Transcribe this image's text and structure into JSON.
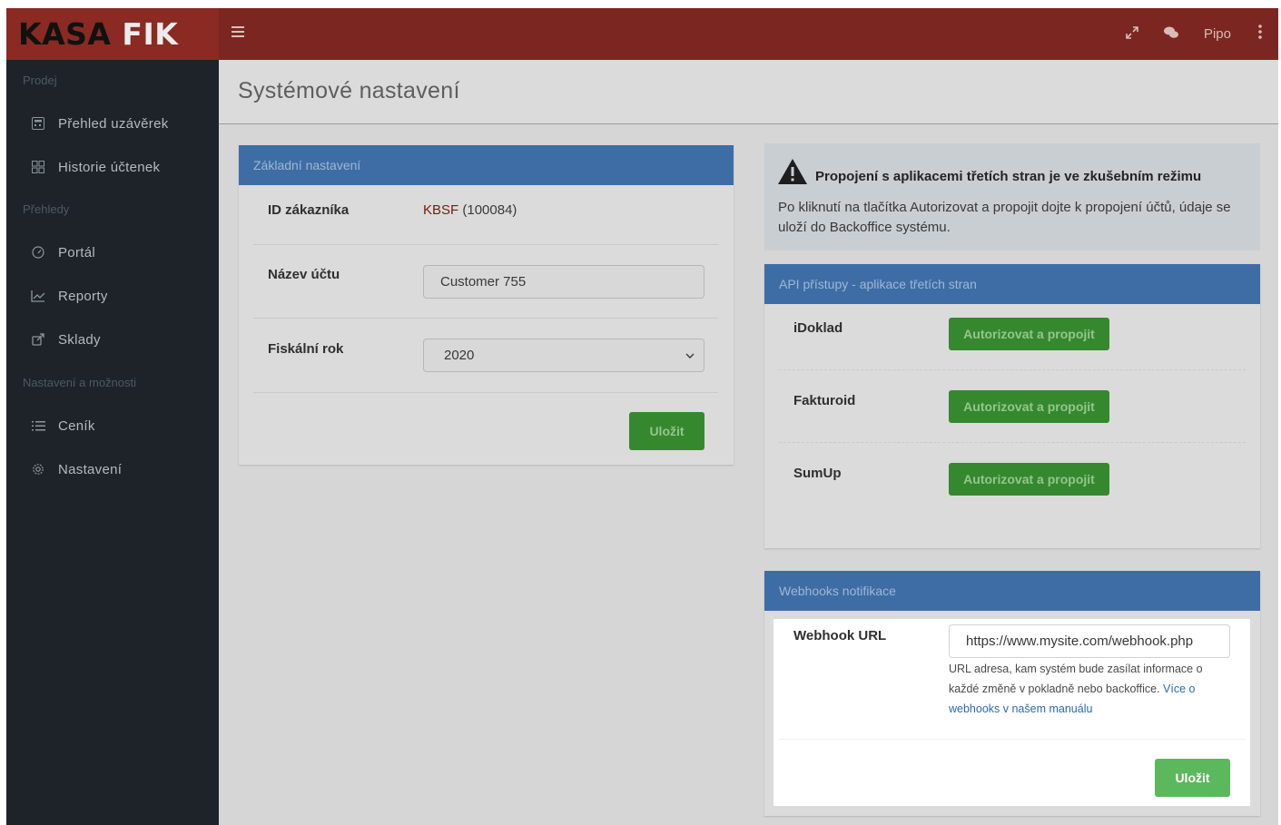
{
  "brand": {
    "part1": "KASA",
    "part2": "FIK"
  },
  "topbar": {
    "menu_icon": "hamburger-icon",
    "expand_icon": "expand-icon",
    "chat_icon": "chat-icon",
    "user": "Pipo",
    "more_icon": "kebab-icon"
  },
  "sidebar": {
    "sections": [
      "Prodej",
      "Přehledy",
      "Nastavení a možnosti"
    ],
    "items": [
      {
        "label": "Přehled uzávěrek",
        "icon": "calculator-icon"
      },
      {
        "label": "Historie účtenek",
        "icon": "grid-icon"
      },
      {
        "label": "Portál",
        "icon": "gauge-icon"
      },
      {
        "label": "Reporty",
        "icon": "chart-icon"
      },
      {
        "label": "Sklady",
        "icon": "share-icon"
      },
      {
        "label": "Ceník",
        "icon": "list-icon"
      },
      {
        "label": "Nastavení",
        "icon": "gear-icon"
      }
    ]
  },
  "page": {
    "title": "Systémové nastavení"
  },
  "basic": {
    "header": "Základní nastavení",
    "customer_id_label": "ID zákazníka",
    "customer_code": "KBSF",
    "customer_number": "(100084)",
    "account_name_label": "Název účtu",
    "account_name_value": "Customer 755",
    "fiscal_year_label": "Fiskální rok",
    "fiscal_year_value": "2020",
    "save_label": "Uložit"
  },
  "alert": {
    "title": "Propojení s aplikacemi třetích stran je ve zkušebním režimu",
    "body": "Po kliknutí na tlačítka Autorizovat a propojit dojte k propojení účtů, údaje se uloží do Backoffice systému."
  },
  "api": {
    "header": "API přístupy - aplikace třetích stran",
    "apps": [
      {
        "name": "iDoklad",
        "button": "Autorizovat a propojit"
      },
      {
        "name": "Fakturoid",
        "button": "Autorizovat a propojit"
      },
      {
        "name": "SumUp",
        "button": "Autorizovat a propojit"
      }
    ]
  },
  "webhooks": {
    "header": "Webhooks notifikace",
    "url_label": "Webhook URL",
    "url_value": "https://www.mysite.com/webhook.php",
    "help_text": "URL adresa, kam systém bude zasílat informace o každé změně v pokladně nebo backoffice.",
    "help_link": "Více o webhooks v našem manuálu",
    "save_label": "Uložit"
  },
  "colors": {
    "topbar": "#7b2620",
    "sidebar": "#1d2329",
    "card_header": "#3e6da6",
    "button_green": "#36882e",
    "button_green_active": "#5cb85c"
  }
}
